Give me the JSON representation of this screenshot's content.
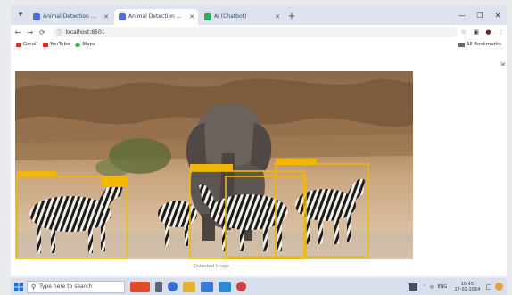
{
  "tabs": [
    {
      "title": "Animal Detection using YOLO",
      "active": false,
      "favicon_color": "#4a6fd8"
    },
    {
      "title": "Animal Detection using YOLO",
      "active": true,
      "favicon_color": "#4a6fd8"
    },
    {
      "title": "AI (Chatbot)",
      "active": false,
      "favicon_color": "#2eae5a"
    }
  ],
  "toolbar": {
    "url": "localhost:8501",
    "extensions_label": "All Bookmarks"
  },
  "bookmarks": [
    {
      "label": "Gmail",
      "color": "#d93025"
    },
    {
      "label": "YouTube",
      "color": "#e62117"
    },
    {
      "label": "Maps",
      "color": "#34a853"
    }
  ],
  "page": {
    "caption": "Detected Image"
  },
  "detections": {
    "box_color": "#f2b705"
  },
  "taskbar": {
    "search_placeholder": "Type here to search",
    "time": "10:45",
    "date": "17-02-2024",
    "tray_text": "ENG"
  }
}
